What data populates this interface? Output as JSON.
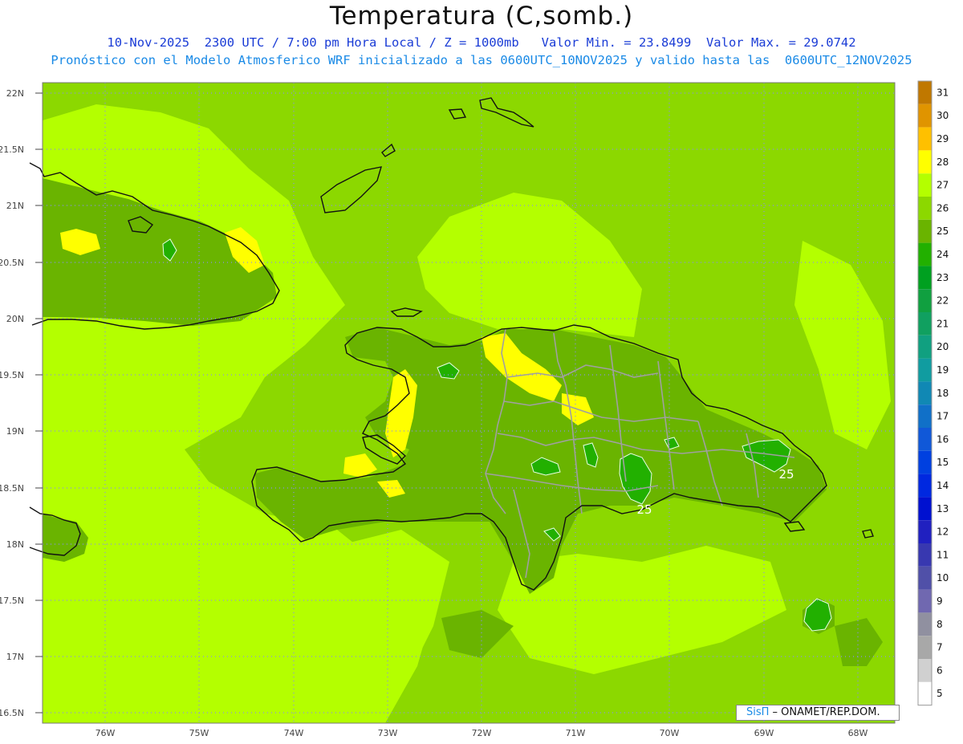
{
  "header": {
    "title": "Temperatura (C,somb.)",
    "line1": "10-Nov-2025  2300 UTC / 7:00 pm Hora Local / Z = 1000mb   Valor Min. = 23.8499  Valor Max. = 29.0742",
    "line2": "Pronóstico con el Modelo Atmosferico WRF inicializado a las 0600UTC_10NOV2025 y valido hasta las  0600UTC_12NOV2025"
  },
  "axes": {
    "lat_labels": [
      "22N",
      "21.5N",
      "21N",
      "20.5N",
      "20N",
      "19.5N",
      "19N",
      "18.5N",
      "18N",
      "17.5N",
      "17N",
      "16.5N"
    ],
    "lon_labels": [
      "76W",
      "75W",
      "74W",
      "73W",
      "72W",
      "71W",
      "70W",
      "69W",
      "68W"
    ]
  },
  "colorbar": {
    "labels": [
      "31",
      "30",
      "29",
      "28",
      "27",
      "26",
      "25",
      "24",
      "23",
      "22",
      "21",
      "20",
      "19",
      "18",
      "17",
      "16",
      "15",
      "14",
      "13",
      "12",
      "11",
      "10",
      "9",
      "8",
      "7",
      "6",
      "5"
    ],
    "colors": [
      "#c07800",
      "#e09400",
      "#ffc000",
      "#ffff00",
      "#b4ff00",
      "#8cd800",
      "#6ab400",
      "#22b000",
      "#00a020",
      "#10a040",
      "#10a060",
      "#10a080",
      "#109ca0",
      "#1088b4",
      "#1070c8",
      "#1058d8",
      "#0040e0",
      "#0028e0",
      "#0010d0",
      "#2020c0",
      "#3838b0",
      "#5050a8",
      "#7068b0",
      "#9090a0",
      "#a8a8a8",
      "#d0d0d0",
      "#ffffff"
    ]
  },
  "contours": {
    "labels": [
      "25",
      "25"
    ]
  },
  "credit": {
    "brand": "SisΠ",
    "text": " – ONAMET/REP.DOM."
  },
  "colors": {
    "sea": "#8cd800",
    "warm": "#b4ff00",
    "hot": "#ffff00",
    "land": "#6ab400",
    "cool": "#22b000",
    "coast": "#111111",
    "border": "#a0a0a0",
    "grid": "#8c8cf0"
  }
}
